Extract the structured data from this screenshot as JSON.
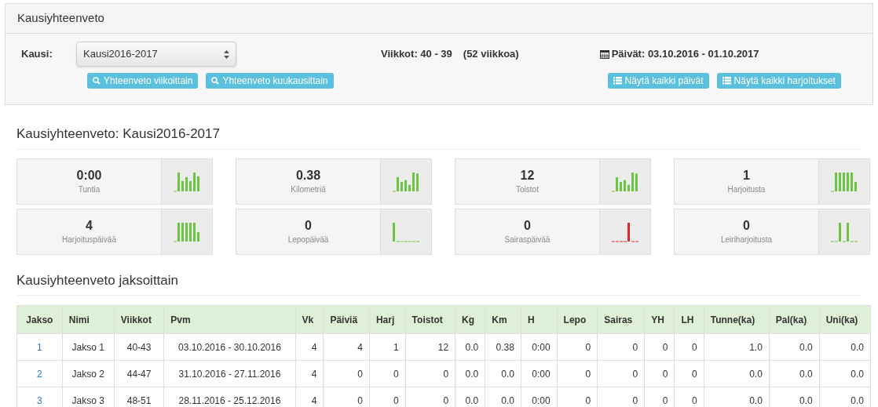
{
  "panel": {
    "title": "Kausiyhteenveto",
    "season_label": "Kausi:",
    "season_select": "Kausi2016-2017",
    "weeks": "Viikkot: 40 - 39",
    "weeks_count": "(52 viikkoa)",
    "dates": "Päivät: 03.10.2016 - 01.10.2017",
    "buttons": [
      {
        "label": "Yhteenveto viikoittain",
        "kind": "zoom"
      },
      {
        "label": "Yhteenveto kuukausittain",
        "kind": "zoom"
      },
      {
        "label": "Näytä kaikki päivät",
        "kind": "list"
      },
      {
        "label": "Näytä kaikki harjoitukset",
        "kind": "list"
      }
    ]
  },
  "summary": {
    "title": "Kausiyhteenveto: Kausi2016-2017",
    "stats": [
      {
        "value": "0:00",
        "label": "Tuntia",
        "color": "#6cc644"
      },
      {
        "value": "0.38",
        "label": "Kilometriä",
        "color": "#6cc644"
      },
      {
        "value": "12",
        "label": "Toistot",
        "color": "#6cc644"
      },
      {
        "value": "1",
        "label": "Harjoitusta",
        "color": "#6cc644"
      },
      {
        "value": "4",
        "label": "Harjoituspäivää",
        "color": "#6cc644"
      },
      {
        "value": "0",
        "label": "Lepopäivää",
        "color": "#6cc644"
      },
      {
        "value": "0",
        "label": "Sairaspäivää",
        "color": "#e0262f"
      },
      {
        "value": "0",
        "label": "Leiriharjoitusta",
        "color": "#6cc644"
      }
    ]
  },
  "periods": {
    "title": "Kausiyhteenveto jaksoittain",
    "columns": [
      "Jakso",
      "Nimi",
      "Viikkot",
      "Pvm",
      "Vk",
      "Päiviä",
      "Harj",
      "Toistot",
      "Kg",
      "Km",
      "H",
      "Lepo",
      "Sairas",
      "YH",
      "LH",
      "Tunne(ka)",
      "Pal(ka)",
      "Uni(ka)"
    ],
    "rows": [
      [
        "1",
        "Jakso 1",
        "40-43",
        "03.10.2016 - 30.10.2016",
        "4",
        "4",
        "1",
        "12",
        "0.0",
        "0.38",
        "0:00",
        "0",
        "0",
        "0",
        "0",
        "1.0",
        "0.0",
        "0.0"
      ],
      [
        "2",
        "Jakso 2",
        "44-47",
        "31.10.2016 - 27.11.2016",
        "4",
        "0",
        "0",
        "0",
        "0.0",
        "0.0",
        "0:00",
        "0",
        "0",
        "0",
        "0",
        "0.0",
        "0.0",
        "0.0"
      ],
      [
        "3",
        "Jakso 3",
        "48-51",
        "28.11.2016 - 25.12.2016",
        "4",
        "0",
        "0",
        "0",
        "0.0",
        "0.0",
        "0:00",
        "0",
        "0",
        "0",
        "0",
        "0.0",
        "0.0",
        "0.0"
      ]
    ]
  }
}
